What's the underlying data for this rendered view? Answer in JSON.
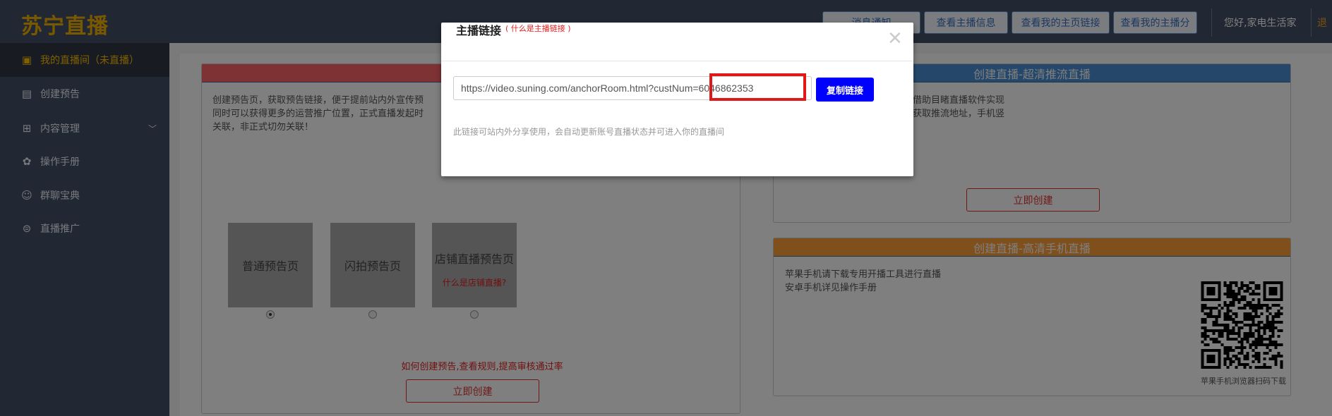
{
  "header": {
    "logo": "苏宁直播",
    "buttons": [
      "消息通知",
      "查看主播信息",
      "查看我的主页链接",
      "查看我的主播分"
    ],
    "greeting": "您好,家电生活家",
    "logout": "退"
  },
  "sidebar": {
    "items": [
      {
        "label": "我的直播间（未直播）",
        "icon": "tv-icon",
        "active": true
      },
      {
        "label": "创建预告",
        "icon": "clipboard-icon"
      },
      {
        "label": "内容管理",
        "icon": "grid-icon",
        "expandable": true
      },
      {
        "label": "操作手册",
        "icon": "manual-icon"
      },
      {
        "label": "群聊宝典",
        "icon": "wechat-icon"
      },
      {
        "label": "直播推广",
        "icon": "chat-bubble-icon"
      }
    ]
  },
  "left_card": {
    "description": [
      "创建预告页，获取预告链接，便于提前站内外宣传预",
      "同时可以获得更多的运营推广位置，正式直播发起时",
      "关联，非正式切勿关联！"
    ],
    "options": [
      {
        "label": "普通预告页",
        "selected": true
      },
      {
        "label": "闪拍预告页",
        "selected": false
      },
      {
        "label": "店铺直播预告页",
        "link": "什么是店铺直播?",
        "selected": false
      }
    ],
    "rules_link": "如何创建预告,查看规则,提高审核通过率",
    "create_button": "立即创建"
  },
  "stream_card": {
    "title": "创建直播-超清推流直播",
    "description": [
      "借助目睹直播软件实现",
      "获取推流地址，手机竖"
    ],
    "create_button": "立即创建"
  },
  "mobile_card": {
    "title": "创建直播-高清手机直播",
    "description": [
      "苹果手机请下载专用开播工具进行直播",
      "安卓手机详见操作手册"
    ],
    "qr_caption": "苹果手机浏览器扫码下载"
  },
  "modal": {
    "title": "主播链接",
    "help_link": "( 什么是主播链接 )",
    "link_value": "https://video.suning.com/anchorRoom.html?custNum=6046862353",
    "copy_button": "复制链接",
    "hint": "此链接可站内外分享使用，会自动更新账号直播状态并可进入你的直播间"
  },
  "colors": {
    "header_bg": "#445066",
    "accent_gold": "#ffc200",
    "preview_banner": "#fe6468",
    "stream_banner": "#4a90d4",
    "mobile_banner": "#ff9e38",
    "copy_button": "#0000ff",
    "highlight_box": "#e01818"
  }
}
